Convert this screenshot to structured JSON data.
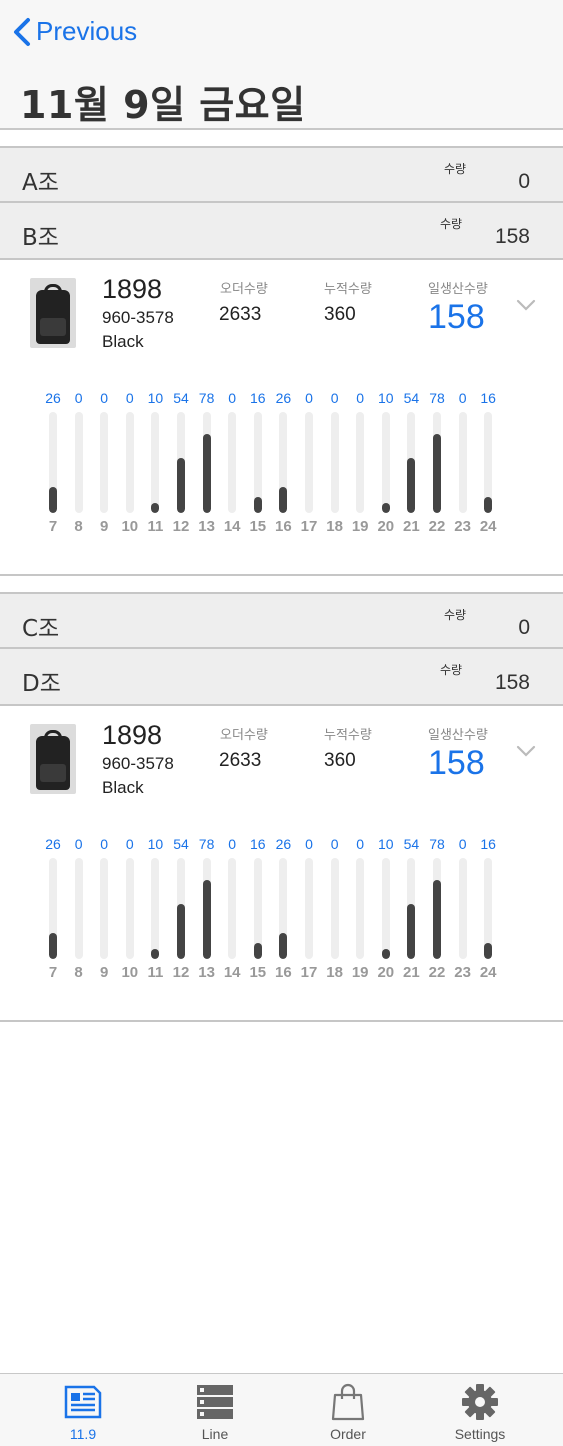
{
  "nav": {
    "back_label": "Previous"
  },
  "page_title": "11월 9일 금요일",
  "groups": [
    {
      "name": "A조",
      "qty_label": "수량",
      "qty": "0"
    },
    {
      "name": "B조",
      "qty_label": "수량",
      "qty": "158"
    },
    {
      "name": "C조",
      "qty_label": "수량",
      "qty": "0"
    },
    {
      "name": "D조",
      "qty_label": "수량",
      "qty": "158"
    }
  ],
  "cards": [
    {
      "code": "1898",
      "model": "960-3578",
      "color": "Black",
      "order_label": "오더수량",
      "order_qty": "2633",
      "cum_label": "누적수량",
      "cum_qty": "360",
      "daily_label": "일생산수량",
      "daily_qty": "158"
    },
    {
      "code": "1898",
      "model": "960-3578",
      "color": "Black",
      "order_label": "오더수량",
      "order_qty": "2633",
      "cum_label": "누적수량",
      "cum_qty": "360",
      "daily_label": "일생산수량",
      "daily_qty": "158"
    }
  ],
  "chart_data": [
    {
      "type": "bar",
      "categories": [
        "7",
        "8",
        "9",
        "10",
        "11",
        "12",
        "13",
        "14",
        "15",
        "16",
        "17",
        "18",
        "19",
        "20",
        "21",
        "22",
        "23",
        "24"
      ],
      "values": [
        26,
        0,
        0,
        0,
        10,
        54,
        78,
        0,
        16,
        26,
        0,
        0,
        0,
        10,
        54,
        78,
        0,
        16
      ],
      "ylim": [
        0,
        100
      ]
    },
    {
      "type": "bar",
      "categories": [
        "7",
        "8",
        "9",
        "10",
        "11",
        "12",
        "13",
        "14",
        "15",
        "16",
        "17",
        "18",
        "19",
        "20",
        "21",
        "22",
        "23",
        "24"
      ],
      "values": [
        26,
        0,
        0,
        0,
        10,
        54,
        78,
        0,
        16,
        26,
        0,
        0,
        0,
        10,
        54,
        78,
        0,
        16
      ],
      "ylim": [
        0,
        100
      ]
    }
  ],
  "tabs": [
    {
      "label": "11.9",
      "icon": "calendar-doc-icon",
      "active": true
    },
    {
      "label": "Line",
      "icon": "server-stack-icon",
      "active": false
    },
    {
      "label": "Order",
      "icon": "shopping-bag-icon",
      "active": false
    },
    {
      "label": "Settings",
      "icon": "gear-icon",
      "active": false
    }
  ],
  "colors": {
    "accent": "#1a73e8",
    "bar": "#444444",
    "track": "#eeeeee"
  }
}
